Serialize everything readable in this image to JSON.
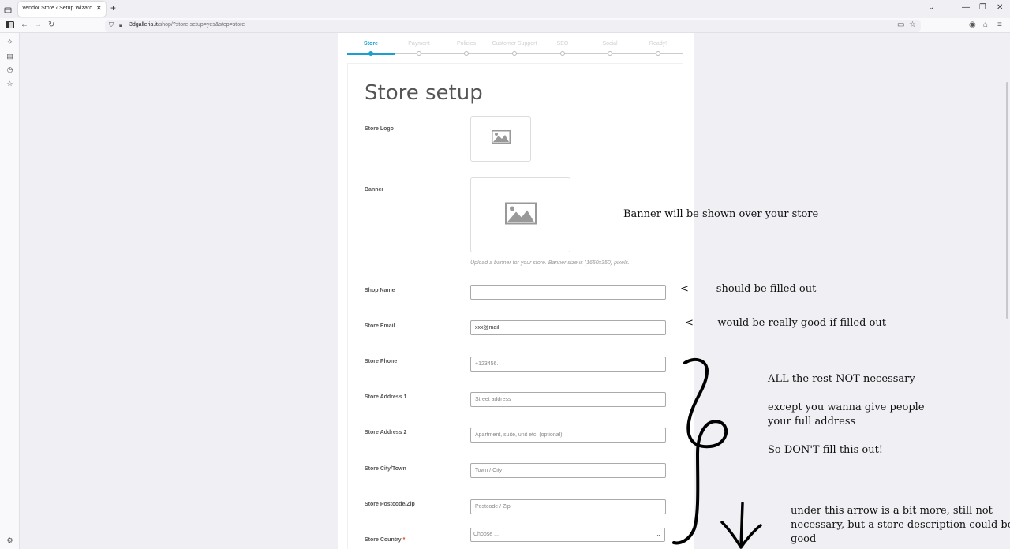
{
  "browser": {
    "tab_title": "Vendor Store ‹ Setup Wizard",
    "url_domain": "3dgalleria.it",
    "url_path": "/shop/?store-setup=yes&step=store"
  },
  "wizard": {
    "steps": [
      "Store",
      "Payment",
      "Policies",
      "Customer Support",
      "SEO",
      "Social",
      "Ready!"
    ],
    "active_step": "Store",
    "title": "Store setup",
    "logo_label": "Store Logo",
    "banner_label": "Banner",
    "banner_hint": "Upload a banner for your store. Banner size is (1650x350) pixels.",
    "fields": {
      "shop_name": {
        "label": "Shop Name",
        "value": "",
        "placeholder": ""
      },
      "email": {
        "label": "Store Email",
        "value": "xxx@mail"
      },
      "phone": {
        "label": "Store Phone",
        "placeholder": "+123456.."
      },
      "address1": {
        "label": "Store Address 1",
        "placeholder": "Street address"
      },
      "address2": {
        "label": "Store Address 2",
        "placeholder": "Apartment, suite, unit etc. (optional)"
      },
      "city": {
        "label": "Store City/Town",
        "placeholder": "Town / City"
      },
      "postcode": {
        "label": "Store Postcode/Zip",
        "placeholder": "Postcode / Zip"
      },
      "country": {
        "label": "Store Country",
        "required_mark": "*",
        "value": "Choose ..."
      }
    }
  },
  "annotations": {
    "banner_note": "Banner will be shown over your store",
    "shop_name_note": "<------- should be filled out",
    "email_note": "<------ would be really good if filled out",
    "rest_line1": "ALL the rest NOT necessary",
    "rest_line2": "except you wanna give people",
    "rest_line3": "your full address",
    "rest_line4": "So DON'T fill this out!",
    "arrow_line1": "under this arrow is a bit more, still not",
    "arrow_line2": "necessary, but a store description could be",
    "arrow_line3": "good"
  },
  "colors": {
    "accent": "#1a9fd0",
    "required": "#e2401c"
  }
}
